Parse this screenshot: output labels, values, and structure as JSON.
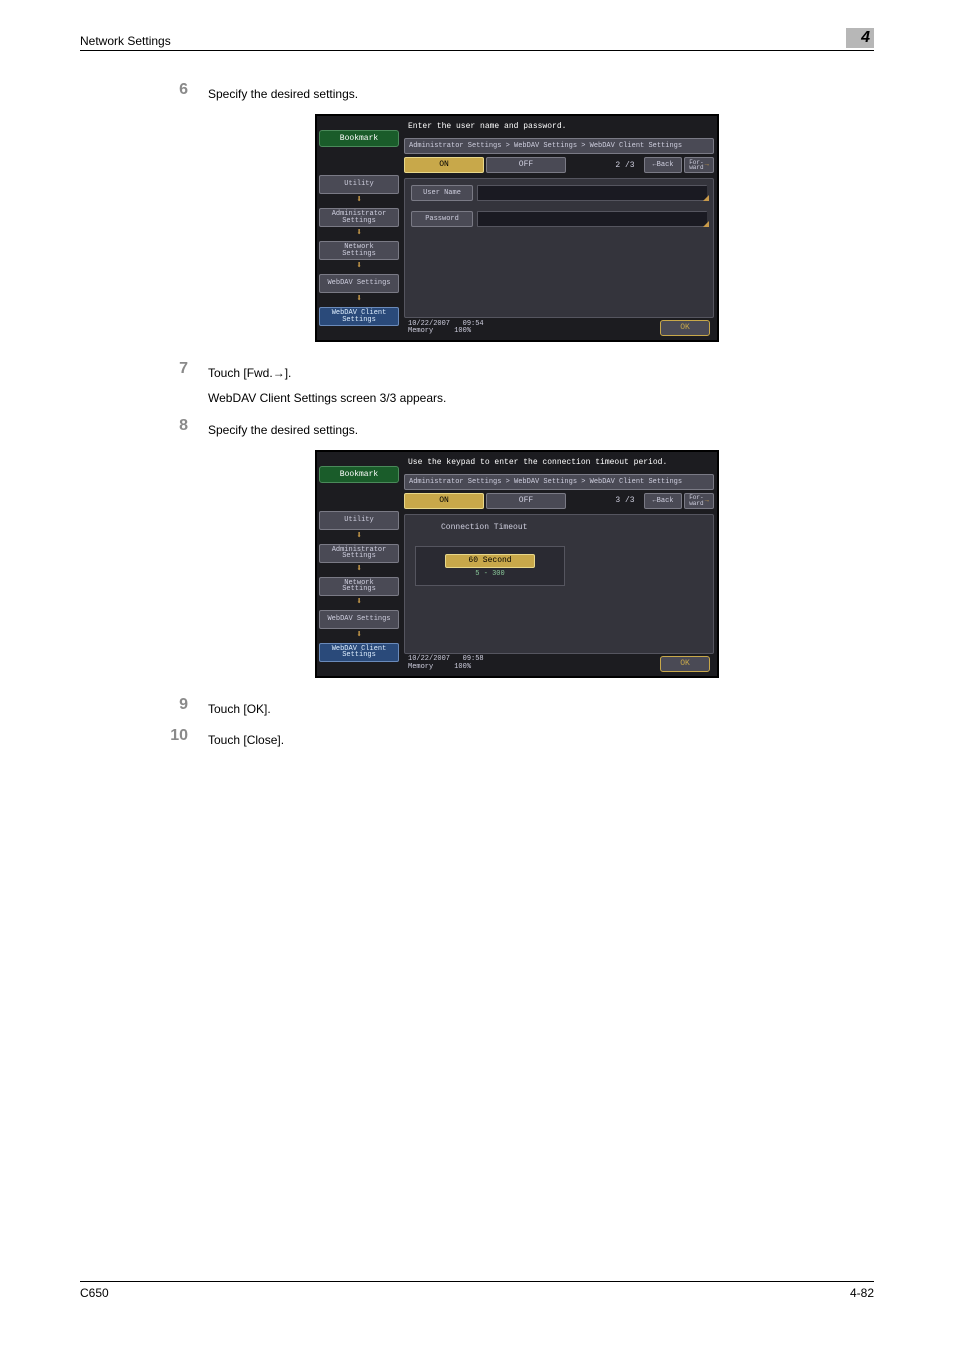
{
  "header": {
    "title": "Network Settings",
    "chapter": "4"
  },
  "steps": {
    "s6": {
      "num": "6",
      "text": "Specify the desired settings."
    },
    "s7": {
      "num": "7",
      "text": "Touch [Fwd.→].",
      "sub": "WebDAV Client Settings screen 3/3 appears."
    },
    "s8": {
      "num": "8",
      "text": "Specify the desired settings."
    },
    "s9": {
      "num": "9",
      "text": "Touch [OK]."
    },
    "s10": {
      "num": "10",
      "text": "Touch [Close]."
    }
  },
  "screen1": {
    "instruction": "Enter the user name and password.",
    "bookmark": "Bookmark",
    "side": {
      "utility": "Utility",
      "admin": "Administrator\nSettings",
      "network": "Network\nSettings",
      "webdav": "WebDAV Settings",
      "client": "WebDAV Client\nSettings"
    },
    "crumb": "Administrator Settings > WebDAV Settings > WebDAV Client Settings",
    "on": "ON",
    "off": "OFF",
    "page": "2 /3",
    "back": "←Back",
    "fwd_label": "For-\nward",
    "fwd_arrw": "→",
    "user": "User Name",
    "pass": "Password",
    "date": "10/22/2007",
    "time": "09:54",
    "mem": "Memory",
    "pct": "100%",
    "ok": "OK"
  },
  "screen2": {
    "instruction": "Use the keypad to enter the connection timeout period.",
    "bookmark": "Bookmark",
    "side": {
      "utility": "Utility",
      "admin": "Administrator\nSettings",
      "network": "Network\nSettings",
      "webdav": "WebDAV Settings",
      "client": "WebDAV Client\nSettings"
    },
    "crumb": "Administrator Settings > WebDAV Settings > WebDAV Client Settings",
    "on": "ON",
    "off": "OFF",
    "page": "3 /3",
    "back": "←Back",
    "fwd_label": "For-\nward",
    "fwd_arrw": "→",
    "ct_title": "Connection Timeout",
    "ct_value": "60 Second",
    "ct_range": "5 - 300",
    "date": "10/22/2007",
    "time": "09:58",
    "mem": "Memory",
    "pct": "100%",
    "ok": "OK"
  },
  "footer": {
    "left": "C650",
    "right": "4-82"
  }
}
